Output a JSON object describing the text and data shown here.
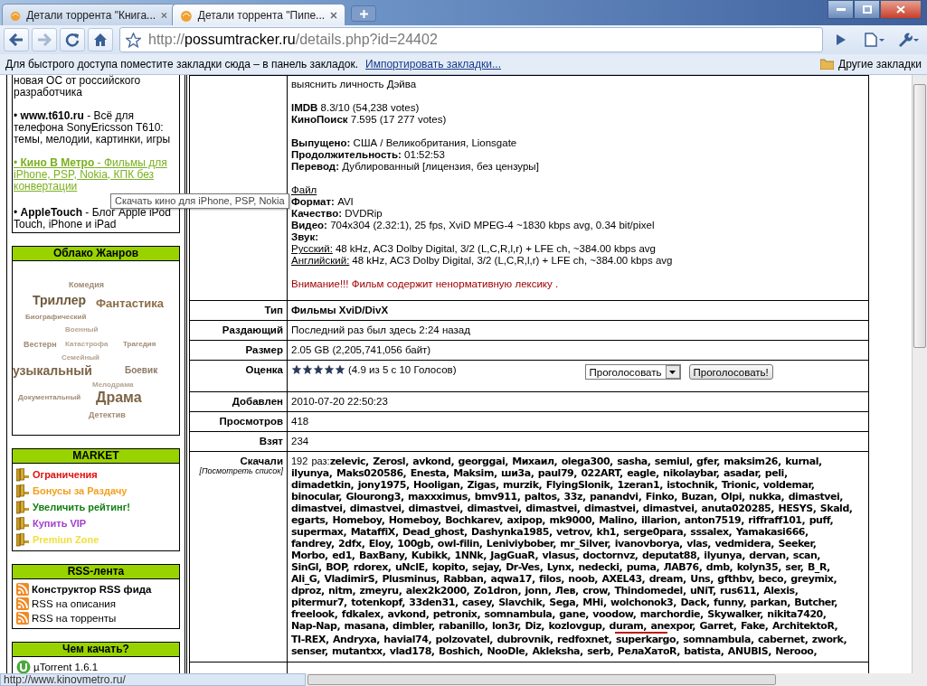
{
  "browser": {
    "tabs": [
      {
        "title": "Детали торрента \"Книга...",
        "selected": false
      },
      {
        "title": "Детали торрента \"Пипе...",
        "selected": true
      }
    ],
    "forward_disabled": true,
    "address": {
      "scheme": "http://",
      "host": "possumtracker.ru",
      "path": "/details.php?id=24402"
    },
    "bookmarks_bar": {
      "hint": "Для быстрого доступа поместите закладки сюда – в панель закладок.",
      "import_link": "Импортировать закладки...",
      "other": "Другие закладки"
    }
  },
  "sidebar": {
    "links": [
      {
        "text": "новая ОС от российского разработчика",
        "hovered": false
      },
      {
        "text": "• **www.t610.ru** - Всё для телефона SonyEricsson T610: темы, мелодии, картинки, игры",
        "hovered": false
      },
      {
        "text": "• **Кино В Метро** - Фильмы для iPhone, PSP, Nokia, КПК без конвертации",
        "hovered": true
      },
      {
        "text": "• **AppleTouch** - Блог Apple iPod Touch, iPhone и iPad",
        "hovered": false
      }
    ],
    "genre_cloud": {
      "title": "Облако Жанров",
      "tags": [
        {
          "label": "Комедия",
          "color": "#a08c74"
        },
        {
          "label": "Триллер",
          "color": "#6e5a3c"
        },
        {
          "label": "Фантастика",
          "color": "#8c6e46"
        },
        {
          "label": "Биографический",
          "color": "#a08c74"
        },
        {
          "label": "Военный",
          "color": "#b4a494"
        },
        {
          "label": "Вестерн",
          "color": "#a08c74"
        },
        {
          "label": "Катастрофа",
          "color": "#b4a494"
        },
        {
          "label": "Трагедия",
          "color": "#a08c74"
        },
        {
          "label": "Семейный",
          "color": "#b4a494"
        },
        {
          "label": "узыкальный",
          "color": "#7d6446"
        },
        {
          "label": "Боевик",
          "color": "#8c7a64"
        },
        {
          "label": "Мелодрама",
          "color": "#b4a494"
        },
        {
          "label": "Документальный",
          "color": "#a08c74"
        },
        {
          "label": "Драма",
          "color": "#7d6446"
        },
        {
          "label": "Детектив",
          "color": "#a08c74"
        }
      ]
    },
    "market": {
      "title": "MARKET",
      "items": [
        {
          "label": "Ограничения",
          "color": "#e01010"
        },
        {
          "label": "Бонусы за Раздачу",
          "color": "#f0a020"
        },
        {
          "label": "Увеличить рейтинг!",
          "color": "#108010"
        },
        {
          "label": "Купить VIP",
          "color": "#a040d0"
        },
        {
          "label": "Premiun Zone",
          "color": "#f0e040"
        }
      ]
    },
    "rss": {
      "title": "RSS-лента",
      "items": [
        {
          "label": "Конструктор RSS фида",
          "bold": true
        },
        {
          "label": "RSS на описания",
          "bold": false
        },
        {
          "label": "RSS на торренты",
          "bold": false
        }
      ]
    },
    "clients": {
      "title": "Чем качать?",
      "items": [
        "µTorrent 1.6.1"
      ]
    }
  },
  "details": {
    "description": {
      "last_line": "выяснить личность Дэйва",
      "ratings": [
        "**IMDB** 8.3/10 (54,238 votes)",
        "**КиноПоиск** 7.595 (17 277 votes)"
      ],
      "release": [
        "**Выпущено:** США / Великобритания, Lionsgate",
        "**Продолжительность:** 01:52:53",
        "**Перевод:** Дублированный [лицензия, без цензуры]"
      ],
      "file_heading": "Файл",
      "file": [
        "**Формат:** AVI",
        "**Качество:** DVDRip",
        "**Видео:** 704x304 (2.32:1), 25 fps, XviD MPEG-4 ~1830 kbps avg, 0.34 bit/pixel",
        "**Звук:**"
      ],
      "audio": [
        {
          "label": "Русский:",
          "value": "48 kHz, AC3 Dolby Digital, 3/2 (L,C,R,l,r) + LFE ch, ~384.00 kbps avg"
        },
        {
          "label": "Английский:",
          "value": "48 kHz, AC3 Dolby Digital, 3/2 (L,C,R,l,r) + LFE ch, ~384.00 kbps avg"
        }
      ],
      "warning": "Внимание!!! Фильм содержит ненормативную лексику ."
    },
    "rows": [
      {
        "kind": "bold",
        "label": "Тип",
        "value": "Фильмы XviD/DivX"
      },
      {
        "kind": "text",
        "label": "Раздающий",
        "value": "Последний раз был здесь 2:24 назад"
      },
      {
        "kind": "text",
        "label": "Размер",
        "value": "2.05 GB (2,205,741,056 байт)"
      },
      {
        "kind": "rating",
        "label": "Оценка",
        "stars": 5,
        "value": "(4.9 из 5 с 10 Голосов)",
        "select": "Проголосовать",
        "button": "Проголосовать!"
      },
      {
        "kind": "text",
        "label": "Добавлен",
        "value": "2010-07-20 22:50:23"
      },
      {
        "kind": "text",
        "label": "Просмотров",
        "value": "418"
      },
      {
        "kind": "text",
        "label": "Взят",
        "value": "234"
      },
      {
        "kind": "users",
        "label": "Скачали",
        "sublabel": "[Посмотреть список]",
        "count": "192 раз:",
        "lines": [
          "zelevic, Zerosl, avkond, georggai, Михаил, olega300, sasha, semiul, gfer, maksim26, kurnal,",
          "ilyunya, Maks020586, Enesta, Maksim, ши3а, paul79, 022ART, eagle, nikolaybar, asadar, peli,",
          "dimadetkin, jony1975, Hooligan, Zigas, murzik, FlyingSlonik, 1zeran1, istochnik, Trionic, voldemar,",
          "binocular, Glourong3, maxxximus, bmv911, paltos, 33z, panandvi, Finko, Buzan, Olpi, nukka, dimastvei,",
          "dimastvei, dimastvei, dimastvei, dimastvei, dimastvei, dimastvei, dimastvei, anuta020285, HESYS, Skald,",
          "egarts, Homeboy, Homeboy, Bochkarev, axipop, mk9000, Malino, illarion, anton7519, riffraff101, puff,",
          "supermax, MataffiX, Dead_ghost, Dashynka1985, vetrov, kh1, serge0para, sssalex, Yamakasi666,",
          "fandrey, 2dfx, Eloy, 100gb, owl-filin, Leniviybober, mr_Silver, ivanovborya, vlas, vedmidera, Seeker,",
          "Morbo, ed1, BaxBany, Kubikk, 1NNk, JagGuaR, vlasus, doctornvz, deputat88, ilyunya, dervan, scan,",
          "SinGl, BOP, rdorex, uNclE, kopito, sejay, Dr-Ves, Lynx, nedecki, puma, ЛАВ76, dmb, kolyn35, ser, B_R,",
          "Ali_G, VladimirS, Plusminus, Rabban, aqwa17, filos, noob, AXEL43, dream, Uns, gfthbv, beco, greymix,",
          "dproz, nitm, zmeyru, alex2k2000, Zo1dron, jonn, Лев, crow, Thindomedel, uNiT, rus611, Alexis,",
          "pitermur7, totenkopf, 33den31, casey, Slavchik, Sega, MHi, wolchonok3, Dack, funny, parkan, Butcher,",
          "freelook, fdkalex, avkond, petronix, somnambula, gane, voodow, marchordie, Skywalker, nikita7420,",
          "Nap-Nap, masana, dimbler, rabanillo, lon3r, Diz, kozlovgup, duram, anexpor, Garret, Fake, ArchitektoR,",
          "TI-REX, Andryxa, havial74, polzovatel, dubrovnik, redfoxnet, superkargo, somnambula, cabernet, zwork,",
          "senser, mutantxx, vlad178, Boshich, NooDle, Akleksha, serb, РелаХатоR, batista, ANUBIS, Nerooo,"
        ]
      }
    ]
  },
  "tooltip": "Скачать кино для iPhone, PSP, Nokia",
  "status_url": "http://www.kinovmetro.ru/"
}
